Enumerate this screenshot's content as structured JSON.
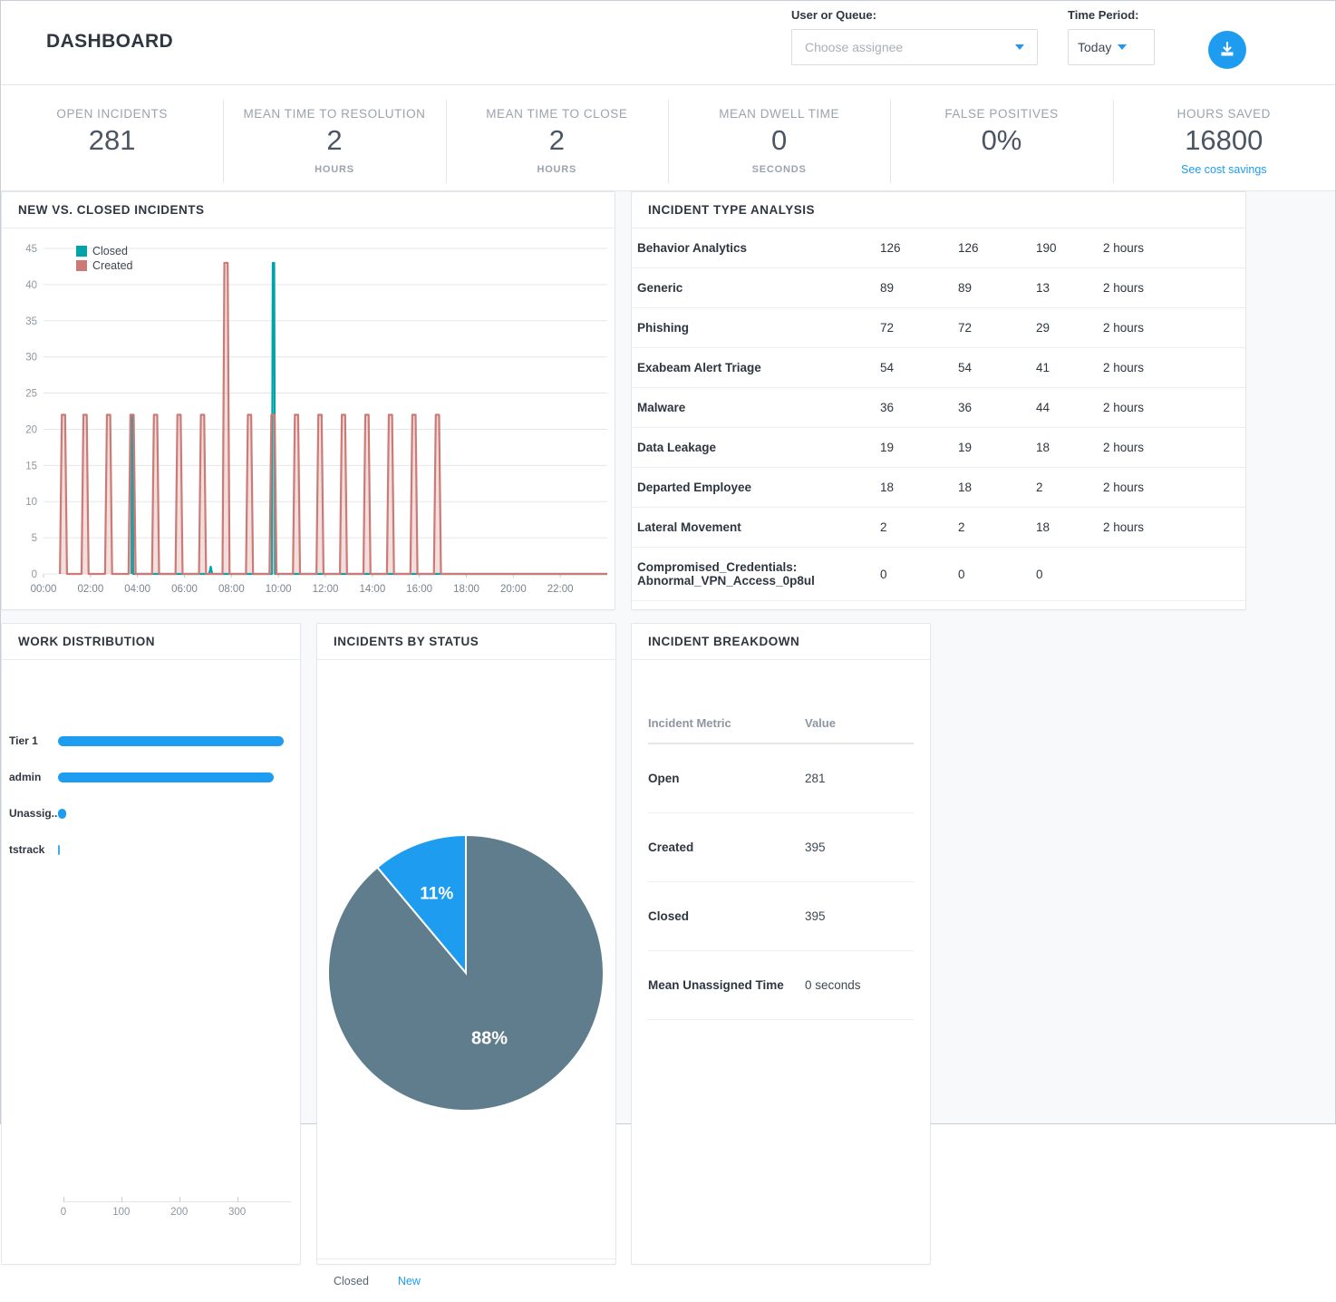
{
  "header": {
    "title": "DASHBOARD",
    "assignee_label": "User or Queue:",
    "assignee_placeholder": "Choose assignee",
    "assignee_value": "",
    "period_label": "Time Period:",
    "period_value": "Today",
    "download_icon": "download-icon"
  },
  "kpis": [
    {
      "label": "OPEN INCIDENTS",
      "value": "281",
      "unit": ""
    },
    {
      "label": "MEAN TIME TO RESOLUTION",
      "value": "2",
      "unit": "HOURS"
    },
    {
      "label": "MEAN TIME TO CLOSE",
      "value": "2",
      "unit": "HOURS"
    },
    {
      "label": "MEAN DWELL TIME",
      "value": "0",
      "unit": "SECONDS"
    },
    {
      "label": "FALSE POSITIVES",
      "value": "0%",
      "unit": ""
    },
    {
      "label": "HOURS SAVED",
      "value": "16800",
      "unit": "",
      "link": "See cost savings"
    }
  ],
  "cards": {
    "line": "NEW VS. CLOSED INCIDENTS",
    "types": "INCIDENT TYPE ANALYSIS",
    "work": "WORK DISTRIBUTION",
    "status": "INCIDENTS BY STATUS",
    "breakdown": "INCIDENT BREAKDOWN"
  },
  "incident_types": {
    "rows": [
      {
        "name": "Behavior Analytics",
        "c1": "126",
        "c2": "126",
        "c3": "190",
        "dur": "2 hours"
      },
      {
        "name": "Generic",
        "c1": "89",
        "c2": "89",
        "c3": "13",
        "dur": "2 hours"
      },
      {
        "name": "Phishing",
        "c1": "72",
        "c2": "72",
        "c3": "29",
        "dur": "2 hours"
      },
      {
        "name": "Exabeam Alert Triage",
        "c1": "54",
        "c2": "54",
        "c3": "41",
        "dur": "2 hours"
      },
      {
        "name": "Malware",
        "c1": "36",
        "c2": "36",
        "c3": "44",
        "dur": "2 hours"
      },
      {
        "name": "Data Leakage",
        "c1": "19",
        "c2": "19",
        "c3": "18",
        "dur": "2 hours"
      },
      {
        "name": "Departed Employee",
        "c1": "18",
        "c2": "18",
        "c3": "2",
        "dur": "2 hours"
      },
      {
        "name": "Lateral Movement",
        "c1": "2",
        "c2": "2",
        "c3": "18",
        "dur": "2 hours"
      },
      {
        "name": "Compromised_Credentials: Abnormal_VPN_Access_0p8ul",
        "c1": "0",
        "c2": "0",
        "c3": "0",
        "dur": ""
      }
    ]
  },
  "breakdown": {
    "col_metric": "Incident Metric",
    "col_value": "Value",
    "rows": [
      {
        "metric": "Open",
        "value": "281"
      },
      {
        "metric": "Created",
        "value": "395"
      },
      {
        "metric": "Closed",
        "value": "395"
      },
      {
        "metric": "Mean Unassigned Time",
        "value": "0 seconds"
      }
    ]
  },
  "status_legend": {
    "closed": "Closed",
    "new": "New"
  },
  "colors": {
    "accent_blue": "#1e9df0",
    "closed_teal": "#00a3a8",
    "created_red": "#cc7a76",
    "pie_gray": "#5f7d8c",
    "pie_blue": "#1e9df0"
  },
  "chart_data": [
    {
      "type": "line",
      "id": "new-vs-closed",
      "title": "NEW VS. CLOSED INCIDENTS",
      "xlabel": "",
      "ylabel": "",
      "ylim": [
        0,
        45
      ],
      "yticks": [
        0,
        5,
        10,
        15,
        20,
        25,
        30,
        35,
        40,
        45
      ],
      "xticks": [
        "00:00",
        "02:00",
        "04:00",
        "06:00",
        "08:00",
        "10:00",
        "12:00",
        "14:00",
        "16:00",
        "18:00",
        "20:00",
        "22:00"
      ],
      "xlim_hours": [
        0,
        24
      ],
      "grid": true,
      "legend": [
        "Closed",
        "Created"
      ],
      "legend_position": "top-left",
      "series": [
        {
          "name": "Created",
          "color": "#cc7a76",
          "points": [
            {
              "t": 0.7,
              "v": 0
            },
            {
              "t": 0.78,
              "v": 22
            },
            {
              "t": 0.92,
              "v": 22
            },
            {
              "t": 1.0,
              "v": 0
            },
            {
              "t": 1.62,
              "v": 0
            },
            {
              "t": 1.7,
              "v": 22
            },
            {
              "t": 1.84,
              "v": 22
            },
            {
              "t": 1.92,
              "v": 0
            },
            {
              "t": 2.62,
              "v": 0
            },
            {
              "t": 2.7,
              "v": 22
            },
            {
              "t": 2.84,
              "v": 22
            },
            {
              "t": 2.92,
              "v": 0
            },
            {
              "t": 3.62,
              "v": 0
            },
            {
              "t": 3.7,
              "v": 22
            },
            {
              "t": 3.84,
              "v": 22
            },
            {
              "t": 3.92,
              "v": 0
            },
            {
              "t": 4.62,
              "v": 0
            },
            {
              "t": 4.7,
              "v": 22
            },
            {
              "t": 4.84,
              "v": 22
            },
            {
              "t": 4.92,
              "v": 0
            },
            {
              "t": 5.62,
              "v": 0
            },
            {
              "t": 5.7,
              "v": 22
            },
            {
              "t": 5.84,
              "v": 22
            },
            {
              "t": 5.92,
              "v": 0
            },
            {
              "t": 6.62,
              "v": 0
            },
            {
              "t": 6.7,
              "v": 22
            },
            {
              "t": 6.84,
              "v": 22
            },
            {
              "t": 6.92,
              "v": 0
            },
            {
              "t": 7.62,
              "v": 0
            },
            {
              "t": 7.7,
              "v": 43
            },
            {
              "t": 7.84,
              "v": 43
            },
            {
              "t": 7.92,
              "v": 0
            },
            {
              "t": 8.62,
              "v": 0
            },
            {
              "t": 8.7,
              "v": 22
            },
            {
              "t": 8.84,
              "v": 22
            },
            {
              "t": 8.92,
              "v": 0
            },
            {
              "t": 9.62,
              "v": 0
            },
            {
              "t": 9.7,
              "v": 22
            },
            {
              "t": 9.84,
              "v": 22
            },
            {
              "t": 9.92,
              "v": 0
            },
            {
              "t": 10.62,
              "v": 0
            },
            {
              "t": 10.7,
              "v": 22
            },
            {
              "t": 10.84,
              "v": 22
            },
            {
              "t": 10.92,
              "v": 0
            },
            {
              "t": 11.62,
              "v": 0
            },
            {
              "t": 11.7,
              "v": 22
            },
            {
              "t": 11.84,
              "v": 22
            },
            {
              "t": 11.92,
              "v": 0
            },
            {
              "t": 12.62,
              "v": 0
            },
            {
              "t": 12.7,
              "v": 22
            },
            {
              "t": 12.84,
              "v": 22
            },
            {
              "t": 12.92,
              "v": 0
            },
            {
              "t": 13.62,
              "v": 0
            },
            {
              "t": 13.7,
              "v": 22
            },
            {
              "t": 13.84,
              "v": 22
            },
            {
              "t": 13.92,
              "v": 0
            },
            {
              "t": 14.62,
              "v": 0
            },
            {
              "t": 14.7,
              "v": 22
            },
            {
              "t": 14.84,
              "v": 22
            },
            {
              "t": 14.92,
              "v": 0
            },
            {
              "t": 15.62,
              "v": 0
            },
            {
              "t": 15.7,
              "v": 22
            },
            {
              "t": 15.84,
              "v": 22
            },
            {
              "t": 15.92,
              "v": 0
            },
            {
              "t": 16.62,
              "v": 0
            },
            {
              "t": 16.7,
              "v": 22
            },
            {
              "t": 16.84,
              "v": 22
            },
            {
              "t": 16.92,
              "v": 0
            },
            {
              "t": 24.0,
              "v": 0
            }
          ]
        },
        {
          "name": "Closed",
          "color": "#00a3a8",
          "points": [
            {
              "t": 3.74,
              "v": 0
            },
            {
              "t": 3.76,
              "v": 22
            },
            {
              "t": 3.8,
              "v": 22
            },
            {
              "t": 3.82,
              "v": 0
            },
            {
              "t": 7.05,
              "v": 0
            },
            {
              "t": 7.12,
              "v": 1
            },
            {
              "t": 7.18,
              "v": 0
            },
            {
              "t": 9.72,
              "v": 0
            },
            {
              "t": 9.76,
              "v": 43
            },
            {
              "t": 9.82,
              "v": 43
            },
            {
              "t": 9.86,
              "v": 0
            },
            {
              "t": 24.0,
              "v": 0
            }
          ]
        }
      ]
    },
    {
      "type": "bar",
      "id": "work-distribution",
      "title": "WORK DISTRIBUTION",
      "orientation": "horizontal",
      "categories": [
        "Tier 1",
        "admin",
        "Unassig...",
        "tstrack"
      ],
      "values": [
        390,
        372,
        14,
        1
      ],
      "xticks": [
        0,
        100,
        200,
        300
      ],
      "xlim": [
        0,
        390
      ],
      "bar_color": "#1e9df0",
      "grid": false
    },
    {
      "type": "pie",
      "id": "incidents-by-status",
      "title": "INCIDENTS BY STATUS",
      "labels": [
        "Closed",
        "New"
      ],
      "values": [
        88,
        11
      ],
      "display_labels": [
        "88%",
        "11%"
      ],
      "colors": [
        "#5f7d8c",
        "#1e9df0"
      ],
      "legend_position": "bottom"
    }
  ]
}
